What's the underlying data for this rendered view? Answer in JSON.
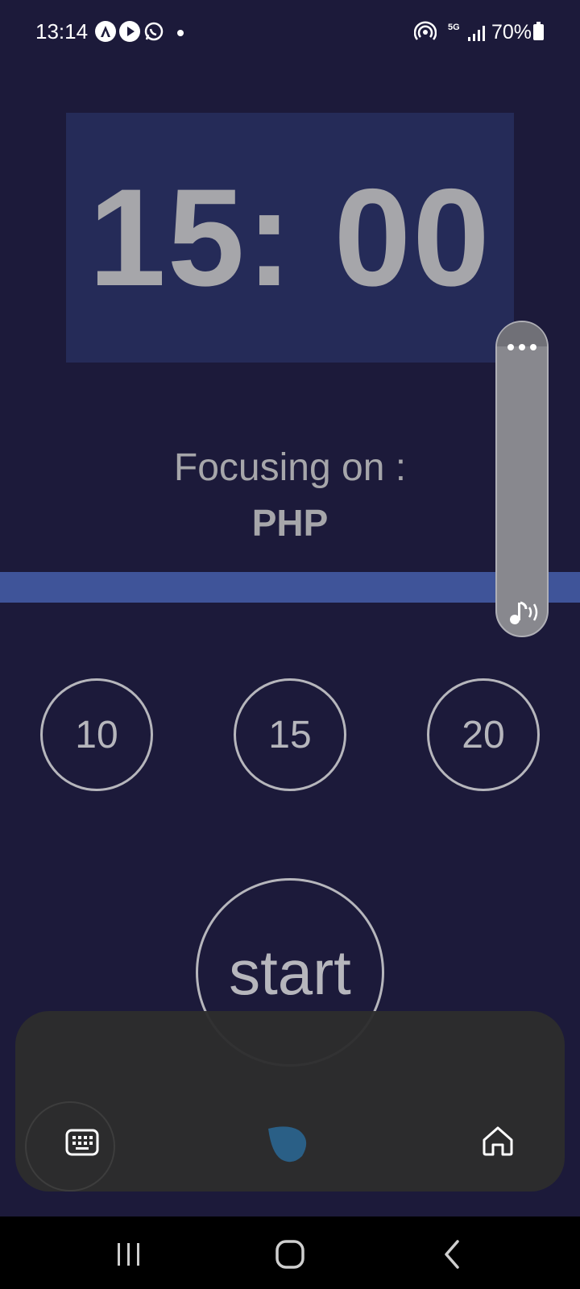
{
  "status_bar": {
    "time": "13:14",
    "network": "5G",
    "battery": "70%"
  },
  "timer": {
    "display": "15: 00"
  },
  "focus": {
    "label": "Focusing on :",
    "subject": "PHP"
  },
  "progress": {
    "fraction": 1.0
  },
  "presets": [
    {
      "label": "10"
    },
    {
      "label": "15"
    },
    {
      "label": "20"
    }
  ],
  "start": {
    "label": "start"
  },
  "colors": {
    "background": "#1c1a3a",
    "timer_panel": "#252b58",
    "progress": "#3f5499",
    "text": "#a6a6aa"
  },
  "icons": {
    "status": [
      "arc-app-icon",
      "play-store-icon",
      "whatsapp-icon"
    ],
    "toolbar": [
      "keyboard-icon",
      "assistant-blob-icon",
      "home-icon"
    ],
    "nav": [
      "recents-icon",
      "home-nav-icon",
      "back-icon"
    ]
  }
}
